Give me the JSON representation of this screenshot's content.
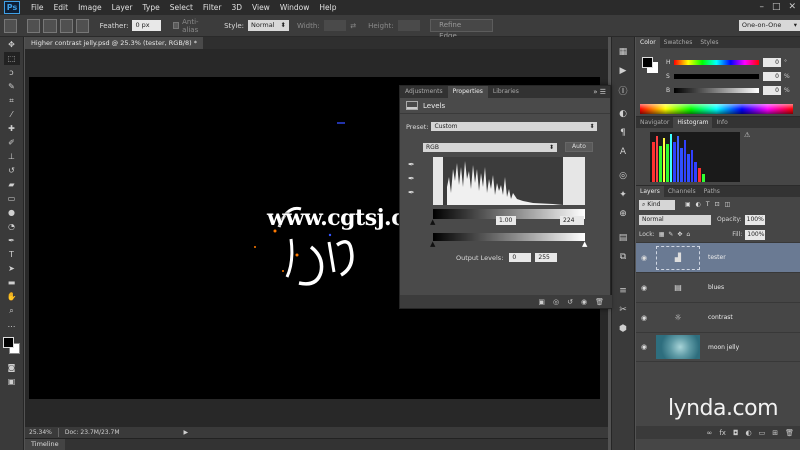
{
  "app": {
    "logo": "Ps"
  },
  "menu": [
    "File",
    "Edit",
    "Image",
    "Layer",
    "Type",
    "Select",
    "Filter",
    "3D",
    "View",
    "Window",
    "Help"
  ],
  "window_controls": {
    "minimize": "–",
    "restore": "□",
    "close": "✕"
  },
  "options_bar": {
    "feather_label": "Feather:",
    "feather_value": "0 px",
    "anti_alias_label": "Anti-alias",
    "style_label": "Style:",
    "style_value": "Normal",
    "width_label": "Width:",
    "height_label": "Height:",
    "refine_edge": "Refine Edge...",
    "workspace": "One-on-One"
  },
  "document": {
    "tab_title": "Higher contrast jelly.psd @ 25.3% (tester, RGB/8) *",
    "close": "×",
    "zoom": "25.34%",
    "doc_info": "Doc: 23.7M/23.7M"
  },
  "timeline": {
    "label": "Timeline"
  },
  "watermark": "www.cgtsj.com",
  "properties": {
    "tabs": [
      "Adjustments",
      "Properties",
      "Libraries"
    ],
    "active_tab": "Properties",
    "title": "Levels",
    "preset_label": "Preset:",
    "preset_value": "Custom",
    "channel_value": "RGB",
    "auto_label": "Auto",
    "input_black": "0",
    "input_gamma": "1.00",
    "input_white": "224",
    "output_label": "Output Levels:",
    "output_black": "0",
    "output_white": "255"
  },
  "color_panel": {
    "tabs": [
      "Color",
      "Swatches",
      "Styles"
    ],
    "h_label": "H",
    "h_value": "0",
    "h_unit": "°",
    "s_label": "S",
    "s_value": "0",
    "s_unit": "%",
    "b_label": "B",
    "b_value": "0",
    "b_unit": "%"
  },
  "histogram_panel": {
    "tabs": [
      "Navigator",
      "Histogram",
      "Info"
    ]
  },
  "layers_panel": {
    "tabs": [
      "Layers",
      "Channels",
      "Paths"
    ],
    "kind_label": "Kind",
    "blend_mode": "Normal",
    "opacity_label": "Opacity:",
    "opacity_value": "100%",
    "lock_label": "Lock:",
    "fill_label": "Fill:",
    "fill_value": "100%",
    "layers": [
      {
        "name": "tester",
        "active": true
      },
      {
        "name": "blues",
        "active": false
      },
      {
        "name": "contrast",
        "active": false
      },
      {
        "name": "moon jelly",
        "active": false
      }
    ]
  },
  "brand": {
    "name": "lynda",
    "suffix": ".com"
  }
}
